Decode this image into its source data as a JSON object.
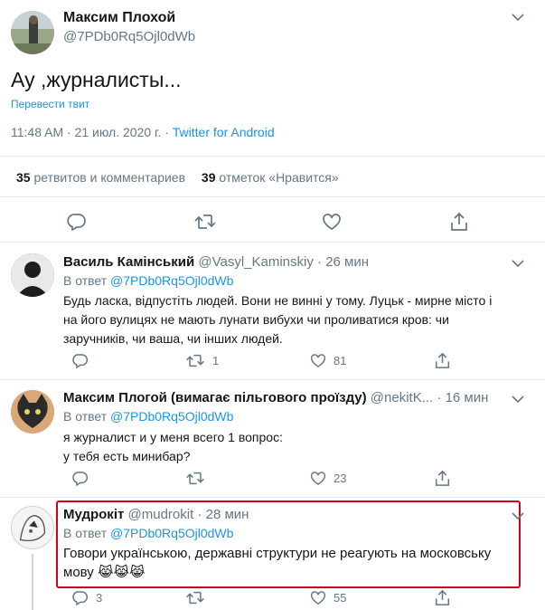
{
  "main_tweet": {
    "author_name": "Максим Плохой",
    "author_handle": "@7PDb0Rq5Ojl0dWb",
    "text": "Ау ,журналисты...",
    "translate_label": "Перевести твит",
    "time": "11:48 AM",
    "dot1": "·",
    "date": "21 июл. 2020 г.",
    "dot2": "·",
    "source": "Twitter for Android",
    "retweets_count": "35",
    "retweets_label": "ретвитов и комментариев",
    "likes_count": "39",
    "likes_label": "отметок «Нравится»"
  },
  "replies": [
    {
      "author_name": "Василь Камінський",
      "author_handle": "@Vasyl_Kaminskiy",
      "dot": "·",
      "time": "26 мин",
      "reply_to_label": "В ответ",
      "reply_to_handle": "@7PDb0Rq5Ojl0dWb",
      "text_lines": [
        "Будь ласка, відпустіть людей. Вони не винні у тому. Луцьк - мирне місто і",
        "на його вулицях не мають лунати вибухи чи проливатися кров: чи",
        "заручників, чи ваша, чи інших людей."
      ],
      "reply_count": "",
      "retweet_count": "1",
      "like_count": "81"
    },
    {
      "author_name": "Максим Плогой (вимагає пільгового проїзду)",
      "author_handle": "@nekitK...",
      "dot": "·",
      "time": "16 мин",
      "reply_to_label": "В ответ",
      "reply_to_handle": "@7PDb0Rq5Ojl0dWb",
      "text_lines": [
        "я журналист и у меня всего 1 вопрос:",
        "у тебя есть минибар?"
      ],
      "reply_count": "",
      "retweet_count": "",
      "like_count": "23"
    },
    {
      "author_name": "Мудрокіт",
      "author_handle": "@mudrokit",
      "dot": "·",
      "time": "28 мин",
      "reply_to_label": "В ответ",
      "reply_to_handle": "@7PDb0Rq5Ojl0dWb",
      "text_lines": [
        "Говори українською, державні структури не реагують на московську",
        "мову 😹😹😹"
      ],
      "reply_count": "3",
      "retweet_count": "",
      "like_count": "55"
    }
  ],
  "colors": {
    "link": "#1b95e0",
    "muted": "#657786",
    "highlight_border": "#d0021b"
  }
}
